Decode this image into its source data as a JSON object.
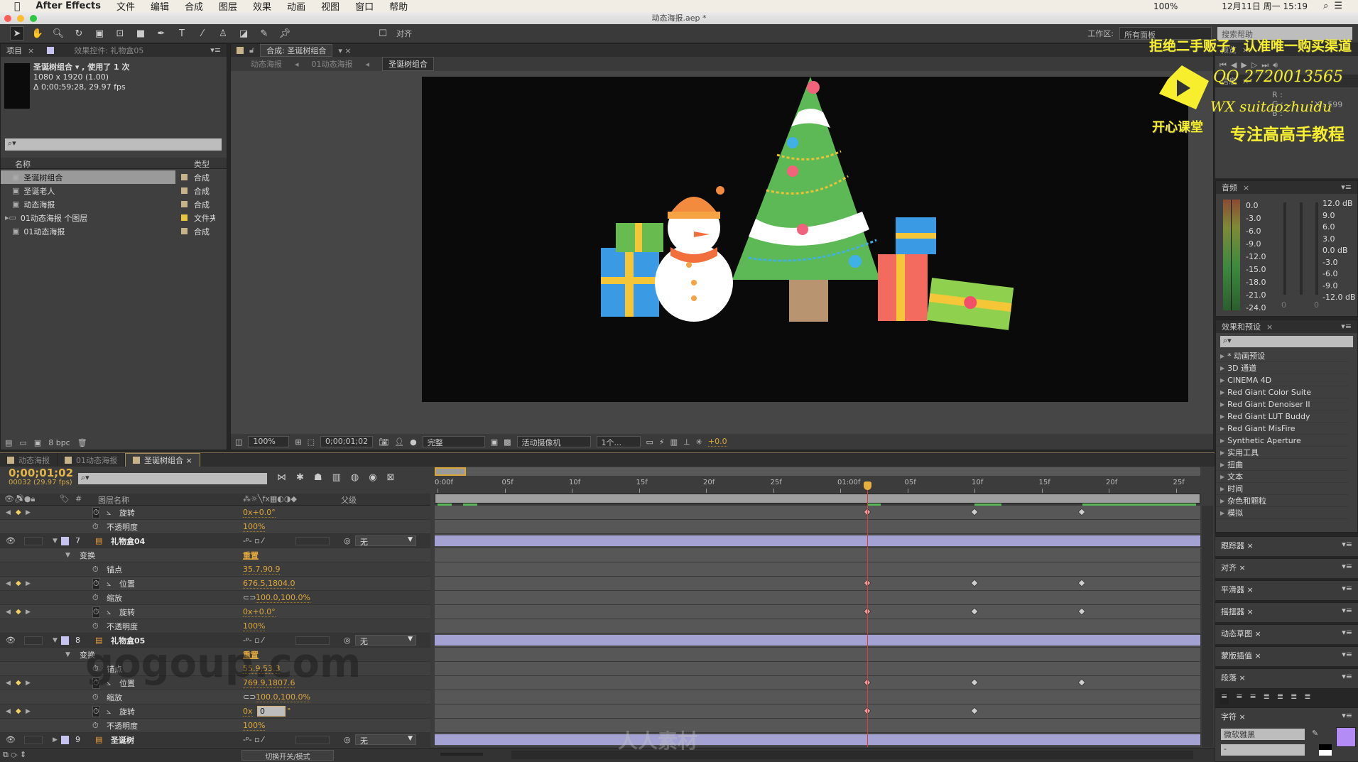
{
  "menubar": {
    "items": [
      "After Effects",
      "文件",
      "编辑",
      "合成",
      "图层",
      "效果",
      "动画",
      "视图",
      "窗口",
      "帮助"
    ],
    "battery": "100%",
    "datetime": "12月11日 周一  15:19"
  },
  "window": {
    "title": "动态海报.aep *"
  },
  "toolbar": {
    "snap_label": "对齐",
    "workspace_label": "工作区:",
    "workspace_value": "所有面板",
    "search_placeholder": "搜索帮助"
  },
  "project": {
    "tab": "项目",
    "effects_tab": "效果控件: 礼物盒05",
    "info": {
      "name": "圣诞树组合 ▾ , 使用了 1 次",
      "size": "1080 x 1920 (1.00)",
      "duration": "Δ 0;00;59;28, 29.97 fps"
    },
    "columns": {
      "name": "名称",
      "type": "类型"
    },
    "items": [
      {
        "name": "圣诞树组合",
        "type": "合成",
        "selected": true
      },
      {
        "name": "圣诞老人",
        "type": "合成"
      },
      {
        "name": "动态海报",
        "type": "合成"
      },
      {
        "name": "01动态海报 个图层",
        "type": "文件夹",
        "folder": true
      },
      {
        "name": "01动态海报",
        "type": "合成"
      }
    ],
    "bpc": "8 bpc"
  },
  "comp": {
    "tab": "合成: 圣诞树组合",
    "breadcrumbs": [
      "动态海报",
      "01动态海报",
      "圣诞树组合"
    ],
    "bar": {
      "zoom": "100%",
      "timecode": "0;00;01;02",
      "resolution": "完整",
      "camera": "活动摄像机",
      "views": "1个...",
      "exposure": "+0.0"
    }
  },
  "timeline": {
    "tabs": [
      "动态海报",
      "01动态海报",
      "圣诞树组合"
    ],
    "active_tab": 2,
    "timecode": "0;00;01;02",
    "frame_info": "00032 (29.97 fps)",
    "headers": {
      "num": "#",
      "name": "图层名称",
      "parent": "父级"
    },
    "ruler": [
      "0:00f",
      "05f",
      "10f",
      "15f",
      "20f",
      "25f",
      "01:00f",
      "05f",
      "10f",
      "15f",
      "20f",
      "25f"
    ],
    "current_frame": 32,
    "rows": [
      {
        "kind": "prop",
        "label": "旋转",
        "value": "0x+0.0°",
        "animated": true,
        "keyframes": [
          32,
          40,
          48
        ]
      },
      {
        "kind": "prop",
        "label": "不透明度",
        "value": "100%"
      },
      {
        "kind": "layer",
        "num": "7",
        "name": "礼物盒04",
        "parent": "无"
      },
      {
        "kind": "group",
        "label": "变换",
        "value": "重置"
      },
      {
        "kind": "prop",
        "label": "锚点",
        "value": "35.7,90.9"
      },
      {
        "kind": "prop",
        "label": "位置",
        "value": "676.5,1804.0",
        "animated": true,
        "keyframes": [
          32,
          40,
          48
        ]
      },
      {
        "kind": "prop",
        "label": "缩放",
        "value": "100.0,100.0%",
        "link": true
      },
      {
        "kind": "prop",
        "label": "旋转",
        "value": "0x+0.0°",
        "animated": true,
        "keyframes": [
          32,
          40,
          48
        ]
      },
      {
        "kind": "prop",
        "label": "不透明度",
        "value": "100%"
      },
      {
        "kind": "layer",
        "num": "8",
        "name": "礼物盒05",
        "parent": "无"
      },
      {
        "kind": "group",
        "label": "变换",
        "value": "重置"
      },
      {
        "kind": "prop",
        "label": "锚点",
        "value": "55.9,53.3"
      },
      {
        "kind": "prop",
        "label": "位置",
        "value": "769.9,1807.6",
        "animated": true,
        "keyframes": [
          32,
          40,
          48
        ]
      },
      {
        "kind": "prop",
        "label": "缩放",
        "value": "100.0,100.0%",
        "link": true
      },
      {
        "kind": "prop",
        "label": "旋转",
        "value": "0x",
        "edit": "0",
        "suffix": "°",
        "animated": true,
        "keyframes": [
          32,
          40
        ]
      },
      {
        "kind": "prop",
        "label": "不透明度",
        "value": "100%"
      },
      {
        "kind": "layer",
        "num": "9",
        "name": "圣诞树",
        "parent": "无",
        "collapsed": true
      }
    ],
    "toggle_label": "切换开关/模式"
  },
  "preview": {
    "tab": "预览",
    "info_tab": "信息",
    "r": "R :",
    "g": "G :",
    "b": "B :",
    "x": "X : 599"
  },
  "audio": {
    "tab": "音频",
    "left_scale": [
      "0.0",
      "-3.0",
      "-6.0",
      "-9.0",
      "-12.0",
      "-15.0",
      "-18.0",
      "-21.0",
      "-24.0"
    ],
    "right_scale": [
      "12.0 dB",
      "9.0",
      "6.0",
      "3.0",
      "0.0 dB",
      "-3.0",
      "-6.0",
      "-9.0",
      "-12.0 dB"
    ],
    "left_value": "0",
    "right_value": "0"
  },
  "effects": {
    "tab": "效果和预设",
    "items": [
      "* 动画预设",
      "3D 通道",
      "CINEMA 4D",
      "Red Giant Color Suite",
      "Red Giant Denoiser II",
      "Red Giant LUT Buddy",
      "Red Giant MisFire",
      "Synthetic Aperture",
      "实用工具",
      "扭曲",
      "文本",
      "时间",
      "杂色和颗粒",
      "模拟"
    ]
  },
  "panels": [
    "跟踪器",
    "对齐",
    "平滑器",
    "摇摆器",
    "动态草图",
    "蒙版插值",
    "段落",
    "字符"
  ],
  "character": {
    "font": "微软雅黑",
    "style": "-",
    "fill_color": "#b48cf5"
  },
  "colors": {
    "value": "#dea63b",
    "layer_bar": "#a3a2d2",
    "playhead": "#e23a3a",
    "label": "#c6c3f0"
  },
  "watermarks": {
    "line1": "拒绝二手贩子，认准唯一购买渠道",
    "qq": "QQ 2720013565",
    "wx": "WX suitaozhuidu",
    "slogan": "专注高高手教程",
    "logo": "开心课堂",
    "site1": "gogoup.com",
    "site2": "人人素材"
  }
}
